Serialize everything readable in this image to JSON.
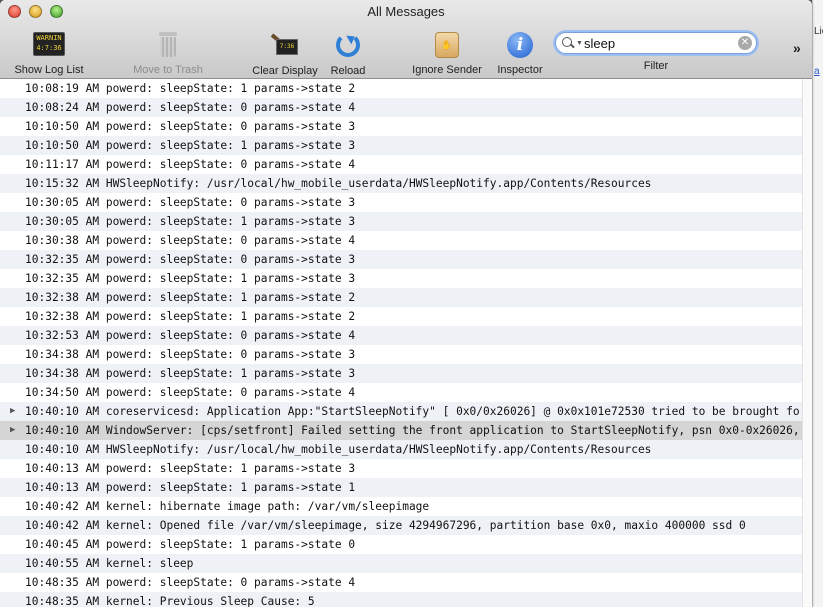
{
  "window": {
    "title": "All Messages"
  },
  "toolbar": {
    "show_log_list": "Show Log List",
    "show_log_list_icon_text": "WARNIN\n4:7:36",
    "move_to_trash": "Move to Trash",
    "clear_display": "Clear Display",
    "clear_display_icon_text": "7:36",
    "reload": "Reload",
    "ignore_sender": "Ignore Sender",
    "inspector": "Inspector",
    "filter_label": "Filter"
  },
  "search": {
    "value": "sleep"
  },
  "background_app": {
    "frag1": "Lic",
    "frag2": "a"
  },
  "log": [
    {
      "time": "10:08:19 AM",
      "msg": "powerd: sleepState: 1 params->state 2"
    },
    {
      "time": "10:08:24 AM",
      "msg": "powerd: sleepState: 0 params->state 4"
    },
    {
      "time": "10:10:50 AM",
      "msg": "powerd: sleepState: 0 params->state 3"
    },
    {
      "time": "10:10:50 AM",
      "msg": "powerd: sleepState: 1 params->state 3"
    },
    {
      "time": "10:11:17 AM",
      "msg": "powerd: sleepState: 0 params->state 4"
    },
    {
      "time": "10:15:32 AM",
      "msg": "HWSleepNotify: /usr/local/hw_mobile_userdata/HWSleepNotify.app/Contents/Resources"
    },
    {
      "time": "10:30:05 AM",
      "msg": "powerd: sleepState: 0 params->state 3"
    },
    {
      "time": "10:30:05 AM",
      "msg": "powerd: sleepState: 1 params->state 3"
    },
    {
      "time": "10:30:38 AM",
      "msg": "powerd: sleepState: 0 params->state 4"
    },
    {
      "time": "10:32:35 AM",
      "msg": "powerd: sleepState: 0 params->state 3"
    },
    {
      "time": "10:32:35 AM",
      "msg": "powerd: sleepState: 1 params->state 3"
    },
    {
      "time": "10:32:38 AM",
      "msg": "powerd: sleepState: 1 params->state 2"
    },
    {
      "time": "10:32:38 AM",
      "msg": "powerd: sleepState: 1 params->state 2"
    },
    {
      "time": "10:32:53 AM",
      "msg": "powerd: sleepState: 0 params->state 4"
    },
    {
      "time": "10:34:38 AM",
      "msg": "powerd: sleepState: 0 params->state 3"
    },
    {
      "time": "10:34:38 AM",
      "msg": "powerd: sleepState: 1 params->state 3"
    },
    {
      "time": "10:34:50 AM",
      "msg": "powerd: sleepState: 0 params->state 4"
    },
    {
      "time": "10:40:10 AM",
      "msg": "coreservicesd: Application App:\"StartSleepNotify\" [ 0x0/0x26026]  @ 0x0x101e72530 tried to be brought fo",
      "disclosure": "▶"
    },
    {
      "time": "10:40:10 AM",
      "msg": "WindowServer: [cps/setfront] Failed setting the front application to StartSleepNotify, psn 0x0-0x26026,",
      "disclosure": "▶",
      "selected": true
    },
    {
      "time": "10:40:10 AM",
      "msg": "HWSleepNotify: /usr/local/hw_mobile_userdata/HWSleepNotify.app/Contents/Resources"
    },
    {
      "time": "10:40:13 AM",
      "msg": "powerd: sleepState: 1 params->state 3"
    },
    {
      "time": "10:40:13 AM",
      "msg": "powerd: sleepState: 1 params->state 1"
    },
    {
      "time": "10:40:42 AM",
      "msg": "kernel: hibernate image path: /var/vm/sleepimage"
    },
    {
      "time": "10:40:42 AM",
      "msg": "kernel: Opened file /var/vm/sleepimage, size 4294967296, partition base 0x0, maxio 400000 ssd 0"
    },
    {
      "time": "10:40:45 AM",
      "msg": "powerd: sleepState: 1 params->state 0"
    },
    {
      "time": "10:40:55 AM",
      "msg": "kernel: sleep"
    },
    {
      "time": "10:48:35 AM",
      "msg": "powerd: sleepState: 0 params->state 4"
    },
    {
      "time": "10:48:35 AM",
      "msg": "kernel: Previous Sleep Cause: 5"
    }
  ]
}
